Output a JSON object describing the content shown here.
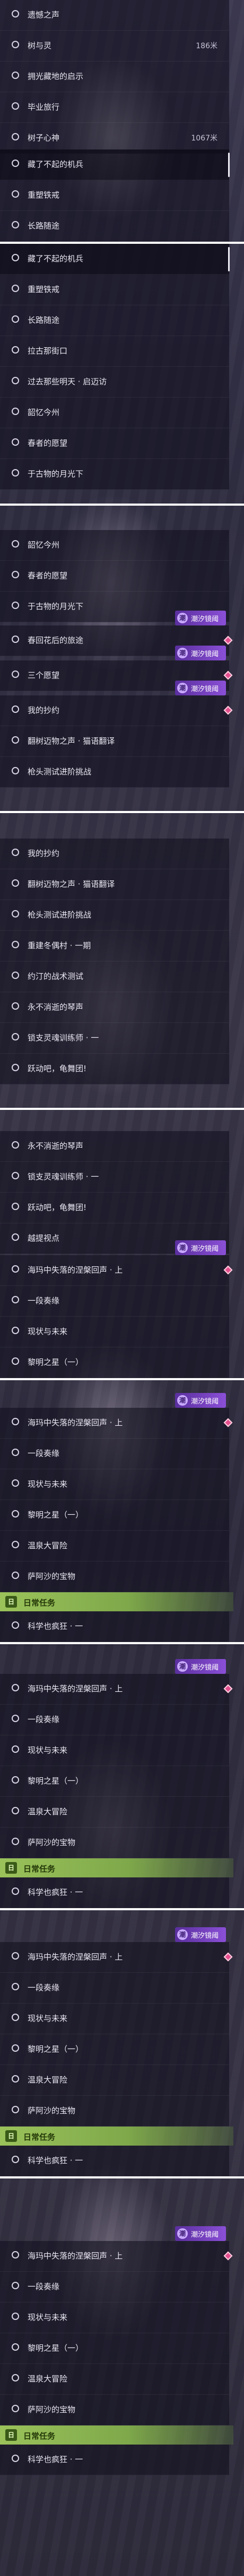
{
  "labels": {
    "l1": "遗憾之声",
    "l2": "树与灵",
    "l3": "拥光藏地的启示",
    "l4": "毕业旅行",
    "l5": "树子心神",
    "l6": "藏了不起的机兵",
    "l7": "重塑铁戒",
    "l8": "长路随途",
    "l9": "拉古那街口",
    "l10": "过去那些明天 · 启迈访",
    "l11": "韶忆今州",
    "l12": "春者的愿望",
    "l13": "于古物的月光下",
    "l14": "春回花后的旅途",
    "l15": "三个愿望",
    "l16": "我的抄约",
    "l17": "翻树迈物之声 · 猫语翻译",
    "l18": "枪头测试进阶挑战",
    "l19": "重建冬偶村 · 一期",
    "l20": "约汀的战术测试",
    "l21": "永不消逝的琴声",
    "l22": "锁支灵魂训练师 · 一",
    "l23": "跃动吧，龟舞团!",
    "l24": "越提视点",
    "l25": "海玛中失落的涅槃回声 · 上",
    "l26": "一段奏缘",
    "l27": "现状与未来",
    "l28": "黎明之星（一）",
    "l29": "温泉大冒险",
    "l30": "萨阿沙的宝物",
    "l31": "科学也疯狂 · 一"
  },
  "distances": {
    "d2": "186米",
    "d5": "1067米"
  },
  "badge_label": "潮汐镜阈",
  "badge_icon": "潮",
  "header_label": "日常任务",
  "header_icon": "日"
}
